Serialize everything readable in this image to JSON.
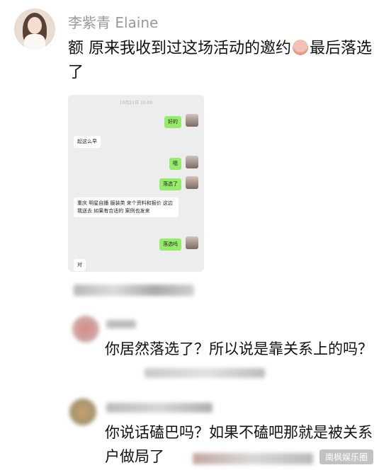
{
  "post": {
    "username": "李紫青 Elaine",
    "text_part1": "额 原来我收到过这场活动的邀约",
    "text_part2": "最后落选了"
  },
  "screenshot": {
    "time": "10月21日 10:00",
    "messages": [
      {
        "side": "right",
        "text": "好的"
      },
      {
        "side": "left",
        "text": "起这么早"
      },
      {
        "side": "right",
        "text": "嗯"
      },
      {
        "side": "right",
        "text": "落选了"
      },
      {
        "side": "left",
        "text": "重庆 明星自播 服装类 来个资料和报价 这边我送去 如果有合适的 案例也发来"
      },
      {
        "side": "right",
        "text": "落选吗"
      },
      {
        "side": "left",
        "text": "对"
      }
    ]
  },
  "comments": [
    {
      "text": "你居然落选了？所以说是靠关系上的吗？"
    },
    {
      "text": "你说话磕巴吗？如果不磕吧那就是被关系户做局了"
    }
  ],
  "watermark": "南枫娱乐圈",
  "colors": {
    "wechat_green": "#95ec69",
    "username_gray": "#9a9a9a"
  }
}
